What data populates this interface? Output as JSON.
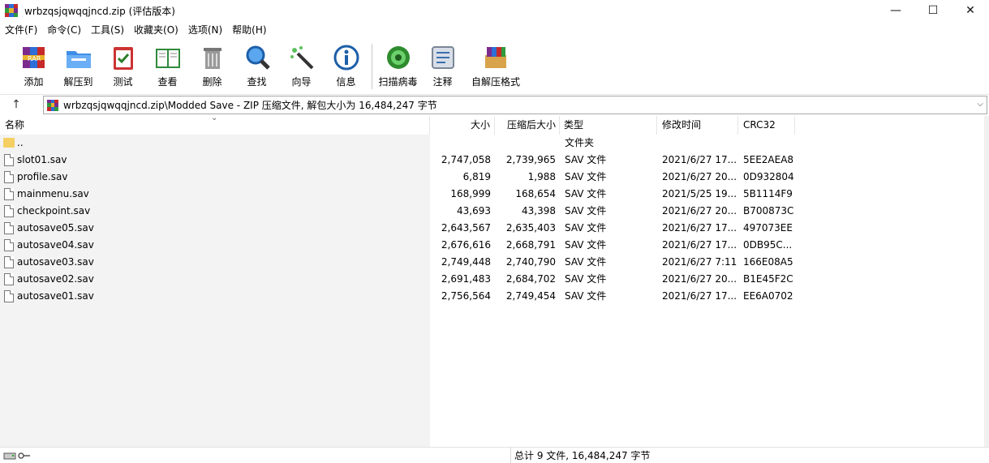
{
  "window": {
    "title": "wrbzqsjqwqqjncd.zip (评估版本)",
    "minimize": "—",
    "maximize": "☐",
    "close": "✕"
  },
  "menu": [
    "文件(F)",
    "命令(C)",
    "工具(S)",
    "收藏夹(O)",
    "选项(N)",
    "帮助(H)"
  ],
  "toolbar": [
    {
      "label": "添加",
      "icon": "add-archive-icon"
    },
    {
      "label": "解压到",
      "icon": "extract-folder-icon"
    },
    {
      "label": "测试",
      "icon": "test-clipboard-icon"
    },
    {
      "label": "查看",
      "icon": "view-book-icon"
    },
    {
      "label": "删除",
      "icon": "delete-trash-icon"
    },
    {
      "label": "查找",
      "icon": "find-magnifier-icon"
    },
    {
      "label": "向导",
      "icon": "wizard-wand-icon"
    },
    {
      "label": "信息",
      "icon": "info-icon"
    },
    {
      "label": "扫描病毒",
      "icon": "virus-scan-icon"
    },
    {
      "label": "注释",
      "icon": "comment-icon"
    },
    {
      "label": "自解压格式",
      "icon": "sfx-archive-icon"
    }
  ],
  "address": {
    "up": "↑",
    "path": "wrbzqsjqwqqjncd.zip\\Modded Save - ZIP 压缩文件, 解包大小为 16,484,247 字节",
    "dropdown": "⌵"
  },
  "columns": {
    "name": "名称",
    "size": "大小",
    "packed": "压缩后大小",
    "type": "类型",
    "modified": "修改时间",
    "crc": "CRC32",
    "sort_indicator": "⌄"
  },
  "files": [
    {
      "name": "..",
      "size": "",
      "packed": "",
      "type": "文件夹",
      "modified": "",
      "crc": "",
      "kind": "folder"
    },
    {
      "name": "slot01.sav",
      "size": "2,747,058",
      "packed": "2,739,965",
      "type": "SAV 文件",
      "modified": "2021/6/27 17...",
      "crc": "5EE2AEA8",
      "kind": "file"
    },
    {
      "name": "profile.sav",
      "size": "6,819",
      "packed": "1,988",
      "type": "SAV 文件",
      "modified": "2021/6/27 20...",
      "crc": "0D932804",
      "kind": "file"
    },
    {
      "name": "mainmenu.sav",
      "size": "168,999",
      "packed": "168,654",
      "type": "SAV 文件",
      "modified": "2021/5/25 19...",
      "crc": "5B1114F9",
      "kind": "file"
    },
    {
      "name": "checkpoint.sav",
      "size": "43,693",
      "packed": "43,398",
      "type": "SAV 文件",
      "modified": "2021/6/27 20...",
      "crc": "B700873C",
      "kind": "file"
    },
    {
      "name": "autosave05.sav",
      "size": "2,643,567",
      "packed": "2,635,403",
      "type": "SAV 文件",
      "modified": "2021/6/27 17...",
      "crc": "497073EE",
      "kind": "file"
    },
    {
      "name": "autosave04.sav",
      "size": "2,676,616",
      "packed": "2,668,791",
      "type": "SAV 文件",
      "modified": "2021/6/27 17...",
      "crc": "0DB95C...",
      "kind": "file"
    },
    {
      "name": "autosave03.sav",
      "size": "2,749,448",
      "packed": "2,740,790",
      "type": "SAV 文件",
      "modified": "2021/6/27 7:11",
      "crc": "166E08A5",
      "kind": "file"
    },
    {
      "name": "autosave02.sav",
      "size": "2,691,483",
      "packed": "2,684,702",
      "type": "SAV 文件",
      "modified": "2021/6/27 20...",
      "crc": "B1E45F2C",
      "kind": "file"
    },
    {
      "name": "autosave01.sav",
      "size": "2,756,564",
      "packed": "2,749,454",
      "type": "SAV 文件",
      "modified": "2021/6/27 17...",
      "crc": "EE6A0702",
      "kind": "file"
    }
  ],
  "status": {
    "summary": "总计 9 文件, 16,484,247 字节",
    "left_icons": [
      "drive-icon",
      "key-icon"
    ]
  }
}
